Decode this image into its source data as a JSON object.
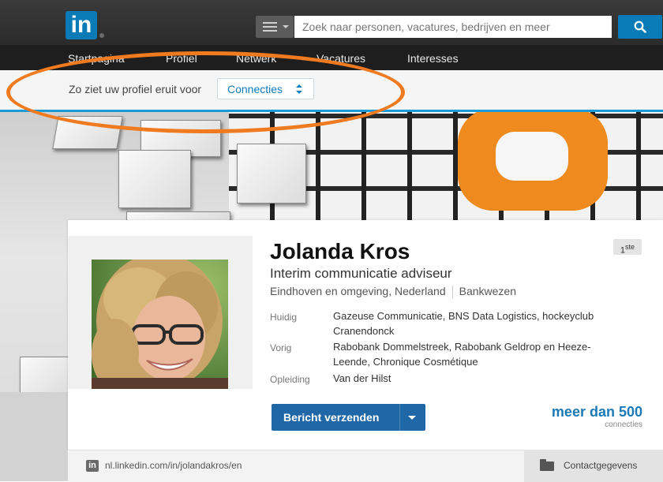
{
  "header": {
    "logo_text": "in",
    "search_placeholder": "Zoek naar personen, vacatures, bedrijven en meer"
  },
  "nav": {
    "items": [
      {
        "label": "Startpagina"
      },
      {
        "label": "Profiel"
      },
      {
        "label": "Netwerk"
      },
      {
        "label": "Vacatures"
      },
      {
        "label": "Interesses"
      }
    ]
  },
  "viewbar": {
    "label": "Zo ziet uw profiel eruit voor",
    "selected": "Connecties"
  },
  "profile": {
    "name": "Jolanda Kros",
    "headline": "Interim communicatie adviseur",
    "location": "Eindhoven en omgeving, Nederland",
    "industry": "Bankwezen",
    "degree": "1",
    "degree_suffix": "ste",
    "rows": [
      {
        "label": "Huidig",
        "value": "Gazeuse Communicatie, BNS Data Logistics, hockeyclub Cranendonck"
      },
      {
        "label": "Vorig",
        "value": "Rabobank Dommelstreek, Rabobank Geldrop en Heeze-Leende, Chronique Cosmétique"
      },
      {
        "label": "Opleiding",
        "value": "Van der Hilst"
      }
    ],
    "send_button": "Bericht verzenden",
    "connections_count": "meer dan 500",
    "connections_label": "connecties"
  },
  "footer": {
    "in_icon_text": "in",
    "url": "nl.linkedin.com/in/jolandakros/en",
    "contact_label": "Contactgegevens"
  },
  "colors": {
    "brand_blue": "#0a7bb6",
    "highlight_orange": "#f07a1f",
    "button_blue": "#1f67a6"
  }
}
